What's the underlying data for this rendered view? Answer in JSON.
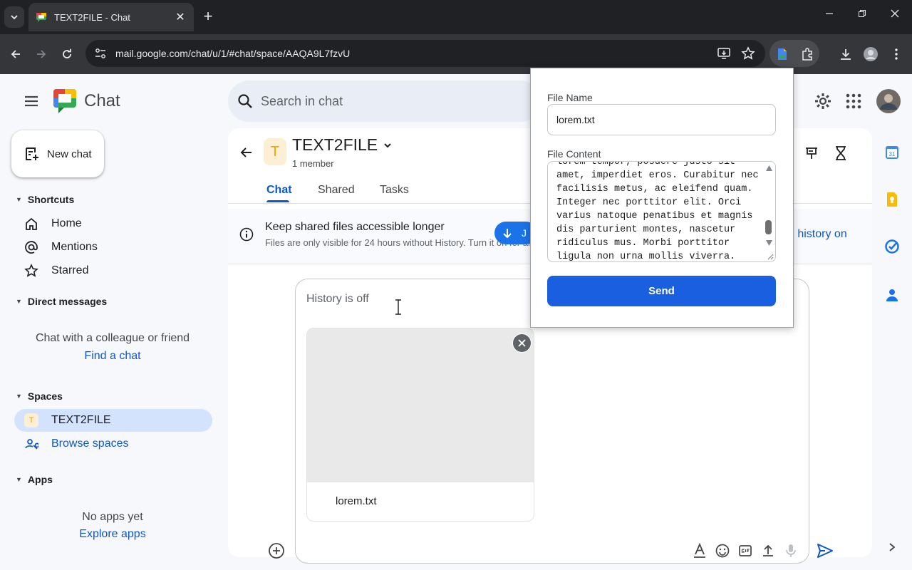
{
  "browser": {
    "tab_title": "TEXT2FILE - Chat",
    "new_tab_glyph": "+",
    "close_glyph": "✕",
    "url": "mail.google.com/chat/u/1/#chat/space/AAQA9L7fzvU"
  },
  "app": {
    "name": "Chat",
    "search_placeholder": "Search in chat",
    "new_chat_label": "New chat"
  },
  "sidebar": {
    "shortcuts_header": "Shortcuts",
    "shortcuts": [
      {
        "label": "Home",
        "icon": "home-icon"
      },
      {
        "label": "Mentions",
        "icon": "at-icon"
      },
      {
        "label": "Starred",
        "icon": "star-icon"
      }
    ],
    "dm_header": "Direct messages",
    "dm_empty": "Chat with a colleague or friend",
    "dm_link": "Find a chat",
    "spaces_header": "Spaces",
    "spaces": [
      {
        "avatar": "T",
        "label": "TEXT2FILE"
      }
    ],
    "browse_spaces": "Browse spaces",
    "apps_header": "Apps",
    "apps_empty": "No apps yet",
    "apps_link": "Explore apps"
  },
  "space": {
    "avatar": "T",
    "title": "TEXT2FILE",
    "members": "1 member",
    "tabs": [
      "Chat",
      "Shared",
      "Tasks"
    ],
    "banner_title": "Keep shared files accessible longer",
    "banner_text": "Files are only visible for 24 hours without History. Turn it on for all",
    "banner_action": "n history on",
    "jump_label": "J"
  },
  "composer": {
    "placeholder": "History is off",
    "attachment_name": "lorem.txt"
  },
  "popup": {
    "file_name_label": "File Name",
    "file_name_value": "lorem.txt",
    "file_content_label": "File Content",
    "file_content_value": "lorem tempor, posuere justo sit amet, imperdiet eros. Curabitur nec facilisis metus, ac eleifend quam. Integer nec porttitor elit. Orci varius natoque penatibus et magnis dis parturient montes, nascetur ridiculus mus. Morbi porttitor ligula non urna mollis viverra.",
    "send_label": "Send"
  },
  "colors": {
    "accent": "#0b57d0",
    "send_button": "#1a5fe0",
    "chrome_dark": "#202124",
    "active_nav": "#d3e3fd"
  }
}
